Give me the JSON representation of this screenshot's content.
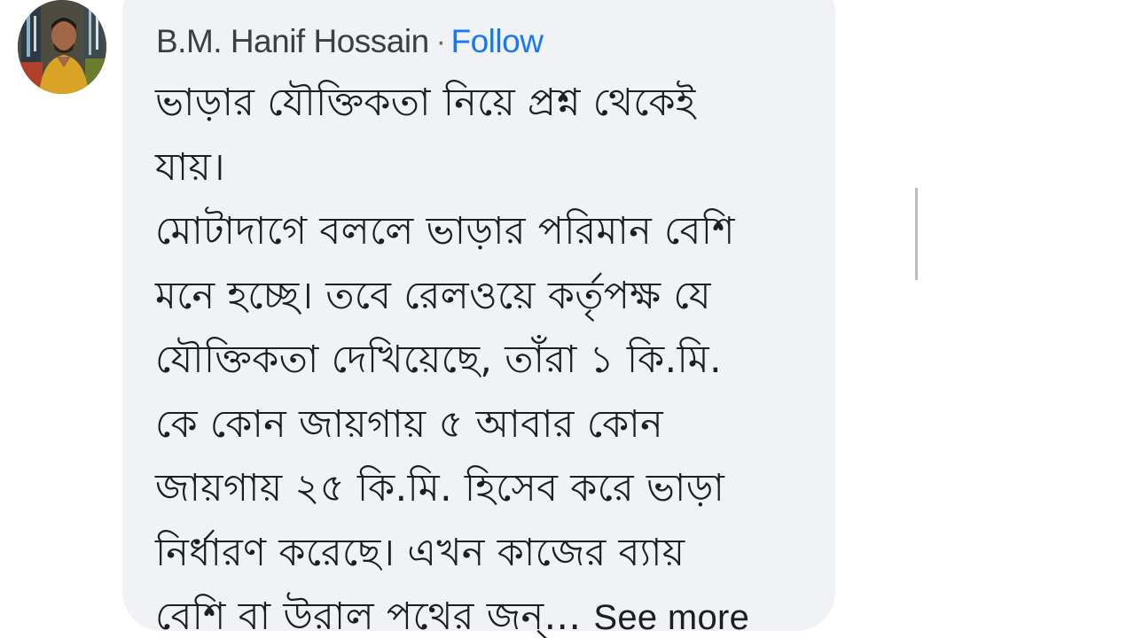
{
  "comment": {
    "author": "B.M. Hanif Hossain",
    "separator": "·",
    "follow_label": "Follow",
    "lines": [
      "ভাড়ার যৌক্তিকতা নিয়ে প্রশ্ন থেকেই",
      "যায়।",
      "মোটাদাগে বললে ভাড়ার পরিমান বেশি",
      "মনে হচ্ছে। তবে রেলওয়ে কর্তৃপক্ষ যে",
      "যৌক্তিকতা দেখিয়েছে, তাঁরা ১ কি.মি.",
      "কে কোন জায়গায় ৫ আবার কোন",
      "জায়গায় ২৫ কি.মি. হিসেব করে ভাড়া",
      "নির্ধারণ করেছে। এখন কাজের ব্যায়",
      "বেশি বা উরাল পথের জন্..."
    ],
    "see_more_label": "See more"
  },
  "colors": {
    "bubble_background": "#f0f2f5",
    "text": "#1c1e21",
    "author_text": "#3b3e43",
    "follow_link": "#1877f2"
  },
  "icons": {
    "avatar": "profile-photo"
  }
}
